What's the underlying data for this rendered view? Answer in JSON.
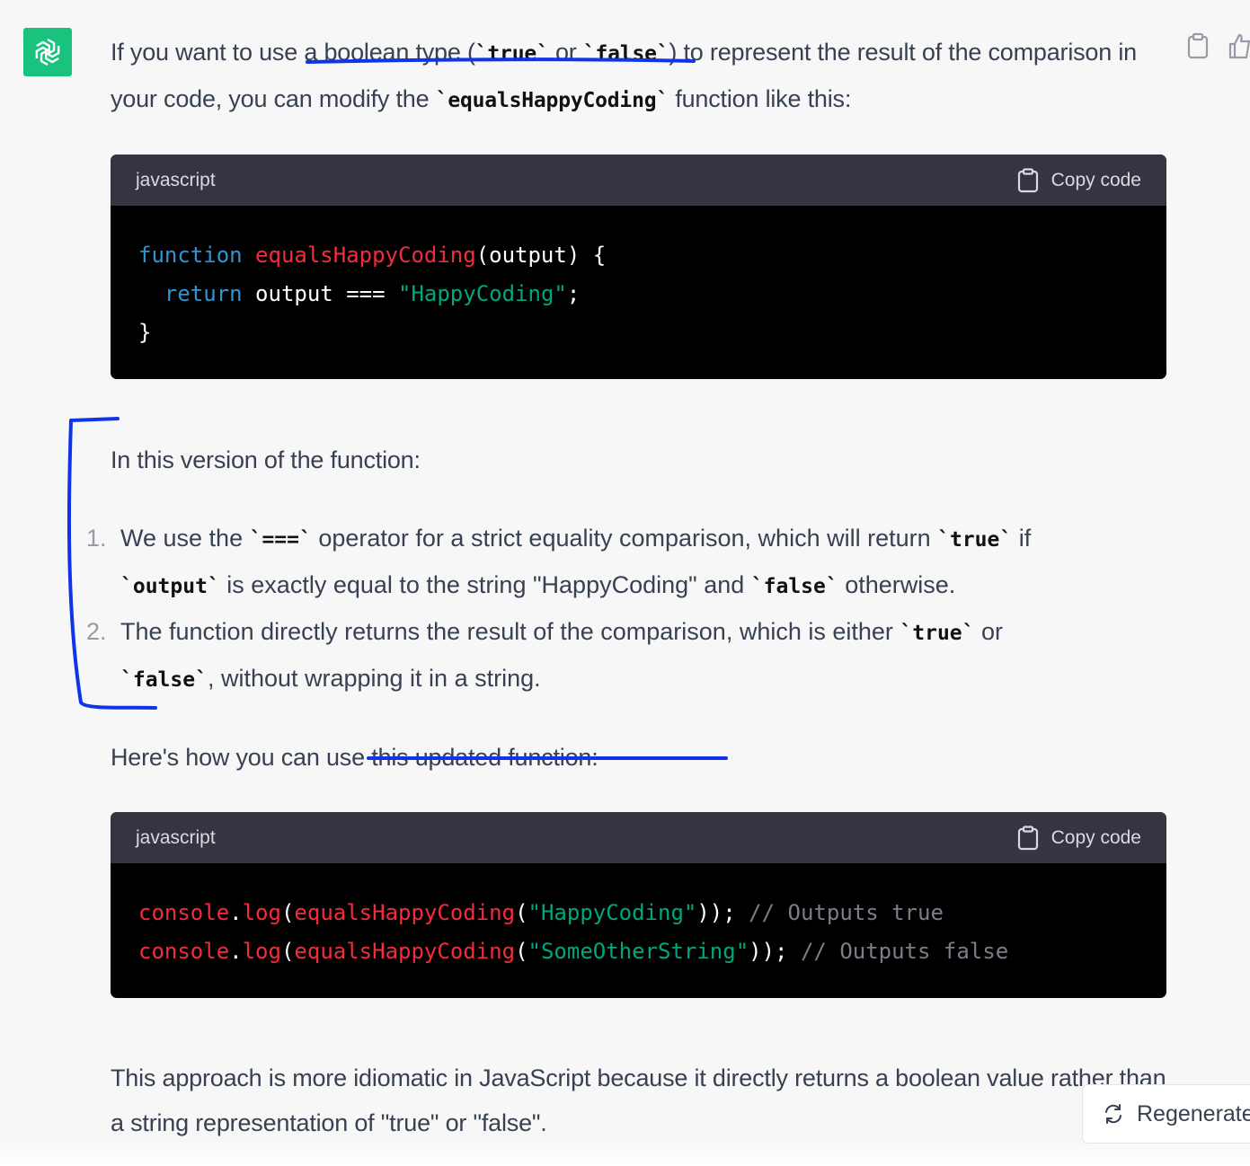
{
  "message": {
    "intro": {
      "t1": "If you want to use a boolean type (",
      "c1": "`true`",
      "t2": " or ",
      "c2": "`false`",
      "t3": ") to represent the result of the comparison in your code, you can modify the ",
      "c3": "`equalsHappyCoding`",
      "t4": " function like this:"
    },
    "code1": {
      "lang": "javascript",
      "copy": "Copy code",
      "l1": {
        "kw": "function",
        "sp": " ",
        "fn": "equalsHappyCoding",
        "rest": "(output) {"
      },
      "l2": {
        "indent": "  ",
        "kw": "return",
        "mid": " output === ",
        "str": "\"HappyCoding\"",
        "end": ";"
      },
      "l3": "}"
    },
    "version_heading": "In this version of the function:",
    "list": [
      {
        "num": "1.",
        "t1": "We use the ",
        "c1": "`===`",
        "t2": " operator for a strict equality comparison, which will return ",
        "c2": "`true`",
        "t3": " if ",
        "c3": "`output`",
        "t4": " is exactly equal to the string \"HappyCoding\" and ",
        "c4": "`false`",
        "t5": " otherwise."
      },
      {
        "num": "2.",
        "t1": "The function directly returns the result of the comparison, which is either ",
        "c1": "`true`",
        "t2": " or ",
        "c2": "`false`",
        "t3": ", without wrapping it in a string."
      }
    ],
    "usage_heading": "Here's how you can use this updated function:",
    "code2": {
      "lang": "javascript",
      "copy": "Copy code",
      "l1": {
        "obj": "console",
        "dot": ".",
        "m": "log",
        "p1": "(",
        "fn": "equalsHappyCoding",
        "p2": "(",
        "str": "\"HappyCoding\"",
        "p3": "));",
        "cm": " // Outputs true"
      },
      "l2": {
        "obj": "console",
        "dot": ".",
        "m": "log",
        "p1": "(",
        "fn": "equalsHappyCoding",
        "p2": "(",
        "str": "\"SomeOtherString\"",
        "p3": "));",
        "cm": " // Outputs false"
      }
    },
    "closing": "This approach is more idiomatic in JavaScript because it directly returns a boolean value rather than a string representation of \"true\" or \"false\"."
  },
  "regenerate_label": "Regenerate",
  "icons": {
    "avatar": "openai-logo-icon",
    "copy": "clipboard-icon",
    "like": "thumbs-up-icon",
    "regenerate": "refresh-icon"
  },
  "colors": {
    "avatar_bg": "#19c37d",
    "code_bg": "#000000",
    "code_header_bg": "#343541",
    "keyword": "#2e95d3",
    "function": "#f22c3d",
    "string": "#00a67d",
    "comment": "#7d7d8a",
    "annotation_ink": "#1034e8"
  }
}
